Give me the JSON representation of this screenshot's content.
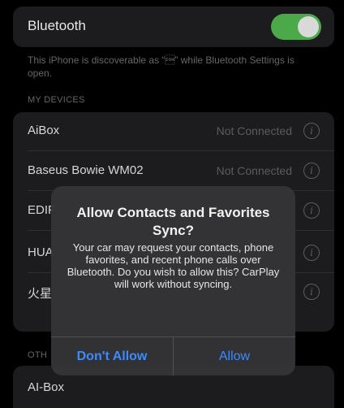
{
  "bluetooth": {
    "label": "Bluetooth",
    "enabled": true,
    "toggle_color": "#4ca94a",
    "discoverable_note": "This iPhone is discoverable as “\u0001” while Bluetooth Settings is open."
  },
  "my_devices": {
    "header": "MY DEVICES",
    "items": [
      {
        "name": "AiBox",
        "status": "Not Connected"
      },
      {
        "name": "Baseus Bowie WM02",
        "status": "Not Connected"
      },
      {
        "name": "EDIF",
        "status": ""
      },
      {
        "name": "HUA",
        "status": ""
      },
      {
        "name": "火星",
        "status": ""
      }
    ]
  },
  "other_devices": {
    "header": "OTH",
    "items": [
      {
        "name": "AI-Box"
      }
    ]
  },
  "alert": {
    "title": "Allow Contacts and Favorites Sync?",
    "message": "Your car may request your contacts, phone favorites, and recent phone calls over Bluetooth. Do you wish to allow this? CarPlay will work without syncing.",
    "cancel_label": "Don't Allow",
    "confirm_label": "Allow",
    "button_color": "#3a8bff"
  }
}
